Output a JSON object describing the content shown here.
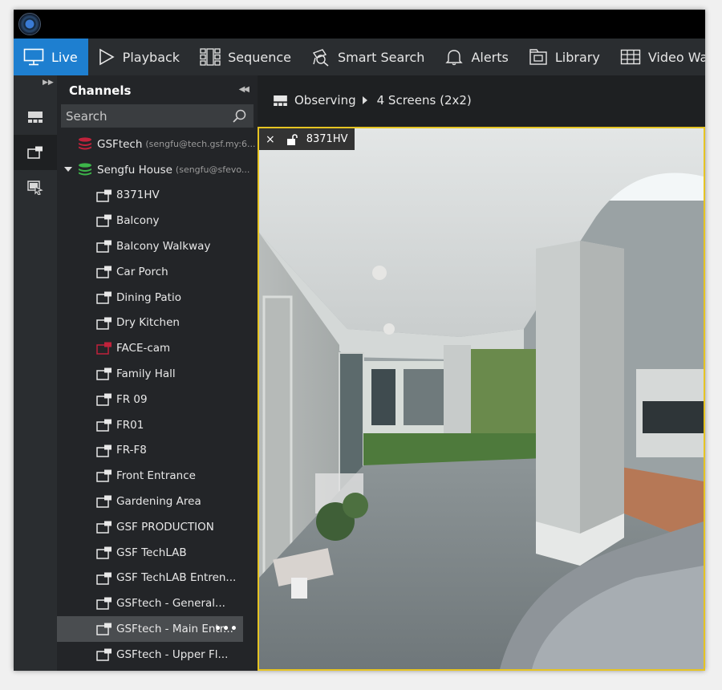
{
  "menu": {
    "items": [
      {
        "label": "Live",
        "icon": "monitor-icon",
        "active": true
      },
      {
        "label": "Playback",
        "icon": "play-icon"
      },
      {
        "label": "Sequence",
        "icon": "sequence-icon"
      },
      {
        "label": "Smart Search",
        "icon": "smart-search-icon"
      },
      {
        "label": "Alerts",
        "icon": "bell-icon"
      },
      {
        "label": "Library",
        "icon": "library-icon"
      },
      {
        "label": "Video Wall",
        "icon": "video-wall-icon"
      }
    ]
  },
  "panel": {
    "title": "Channels",
    "search_placeholder": "Search"
  },
  "tree": {
    "servers": [
      {
        "name": "GSFtech",
        "account": "(sengfu@tech.gsf.my:6...",
        "color": "#c0223b"
      },
      {
        "name": "Sengfu House",
        "account": "(sengfu@sfevo...",
        "color": "#3db54a"
      }
    ],
    "channels": [
      {
        "label": "8371HV"
      },
      {
        "label": "Balcony"
      },
      {
        "label": "Balcony Walkway"
      },
      {
        "label": "Car Porch"
      },
      {
        "label": "Dining Patio"
      },
      {
        "label": "Dry Kitchen"
      },
      {
        "label": "FACE-cam",
        "offline": true
      },
      {
        "label": "Family Hall"
      },
      {
        "label": "FR 09"
      },
      {
        "label": "FR01"
      },
      {
        "label": "FR-F8"
      },
      {
        "label": "Front Entrance"
      },
      {
        "label": "Gardening Area"
      },
      {
        "label": "GSF PRODUCTION"
      },
      {
        "label": "GSF TechLAB"
      },
      {
        "label": "GSF TechLAB Entren..."
      },
      {
        "label": "GSFtech - General..."
      },
      {
        "label": "GSFtech - Main Entr...",
        "selected": true
      },
      {
        "label": "GSFtech - Upper Fl..."
      }
    ],
    "more_label": "•••"
  },
  "breadcrumb": {
    "root": "Observing",
    "layout": "4 Screens (2x2)"
  },
  "video": {
    "close_label": "×",
    "camera_name": "8371HV"
  },
  "colors": {
    "accent": "#1e7fd0",
    "frame_highlight": "#e6c422",
    "offline": "#c0223b"
  }
}
